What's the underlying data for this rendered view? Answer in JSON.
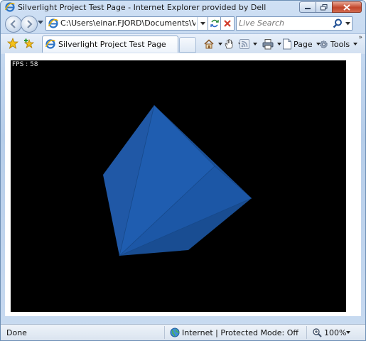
{
  "window": {
    "title": "Silverlight Project Test Page - Internet Explorer provided by Dell",
    "icon": "ie-icon"
  },
  "nav": {
    "address": "C:\\Users\\einar.FJORD\\Documents\\Visual Studio C",
    "search_placeholder": "Live Search"
  },
  "tabs": {
    "active_label": "Silverlight Project Test Page"
  },
  "commands": {
    "page_label": "Page",
    "tools_label": "Tools"
  },
  "content": {
    "fps_text": "FPS : 58",
    "stage_color": "#000000",
    "shape_color": "#1f5fb2"
  },
  "status": {
    "text": "Done",
    "zone": "Internet | Protected Mode: Off",
    "zoom": "100%"
  }
}
